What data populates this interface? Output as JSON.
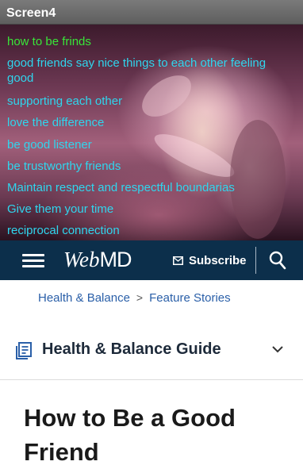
{
  "window": {
    "title": "Screen4"
  },
  "hero": {
    "lines": [
      "how to be frinds",
      "good friends say nice things to each  other feeling",
      "good",
      "supporting each other",
      "love the difference",
      "be good listener",
      "be trustworthy friends",
      "Maintain respect and respectful  boundarias",
      "Give them your time",
      "reciprocal connection"
    ],
    "heading_color": "#39e639",
    "text_color": "#2fd6ee"
  },
  "webmd": {
    "logo_a": "Web",
    "logo_b": "MD",
    "subscribe_label": "Subscribe",
    "bar_color": "#0c2f4b"
  },
  "breadcrumb": {
    "item1": "Health & Balance",
    "separator": ">",
    "item2": "Feature Stories"
  },
  "guide": {
    "title": "Health & Balance Guide"
  },
  "article": {
    "headline": "How to Be a Good Friend"
  }
}
